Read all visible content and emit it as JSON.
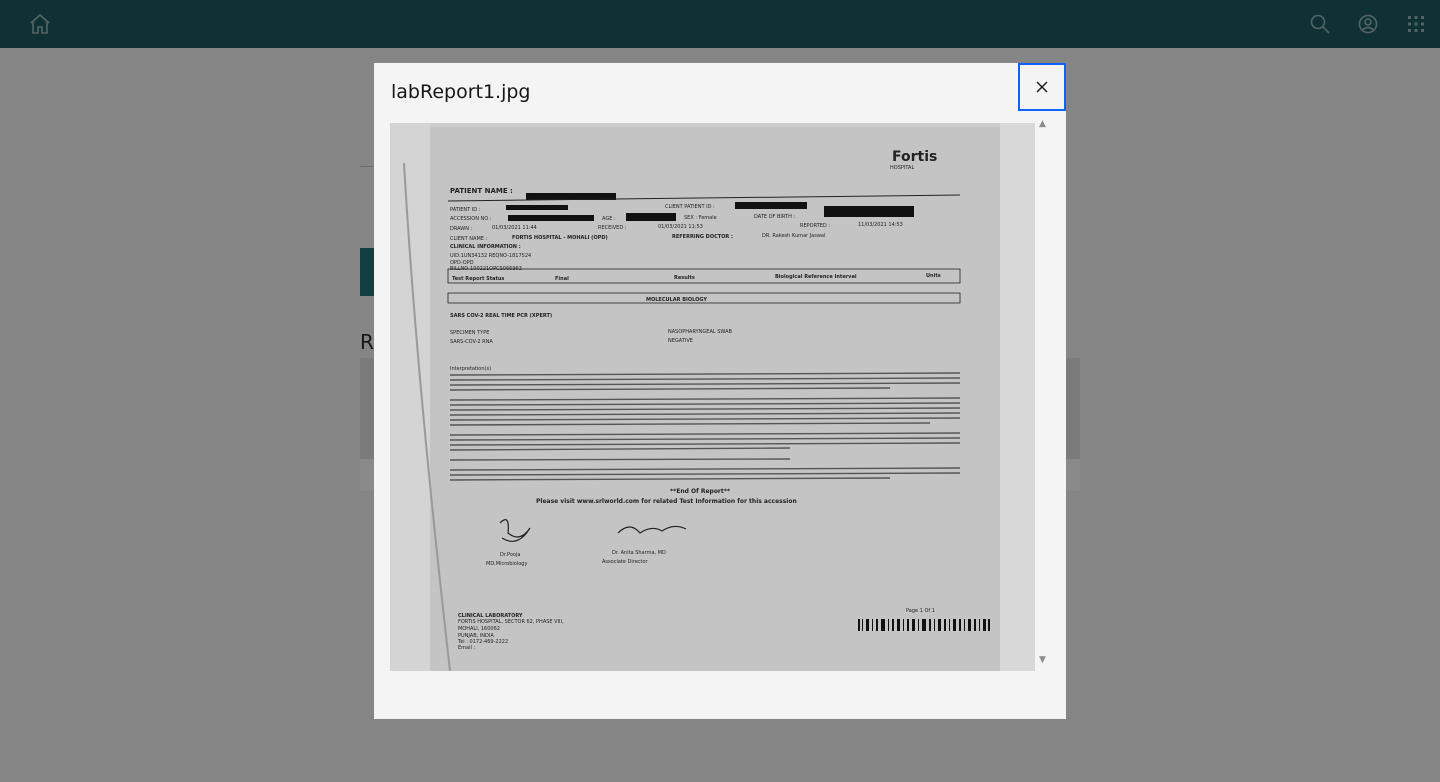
{
  "topbar": {
    "home_icon": "home-icon",
    "search_icon": "search-icon",
    "user_icon": "user-avatar-icon",
    "apps_icon": "app-switcher-icon"
  },
  "background": {
    "heading_initial": "R"
  },
  "modal": {
    "title": "labReport1.jpg",
    "close_icon": "close-icon"
  },
  "document": {
    "logo_text": "Fortis",
    "logo_subtext": "HOSPITAL",
    "patient_name_label": "PATIENT NAME :",
    "patient_id_label": "PATIENT ID :",
    "client_patient_id_label": "CLIENT PATIENT ID :",
    "accession_label": "ACCESSION NO :",
    "age_label": "AGE :",
    "sex_label": "SEX : Female",
    "dob_label": "DATE OF BIRTH :",
    "drawn_label": "DRAWN :",
    "drawn_value": "01/03/2021 11:44",
    "received_label": "RECEIVED :",
    "received_value": "01/03/2021 11:53",
    "reported_label": "REPORTED :",
    "reported_value": "11/03/2021 14:53",
    "client_name_label": "CLIENT NAME :",
    "client_name_value": "FORTIS HOSPITAL - MOHALI (OPD)",
    "referring_label": "REFERRING DOCTOR :",
    "referring_value": "DR. Rakesh Kumar Jaswal",
    "clinical_info_label": "CLINICAL INFORMATION :",
    "clinical_info_lines": [
      "UID:1UN34132 REQNO-1817524",
      "OPD-OPD",
      "BILLNO-100221OPCS066963"
    ],
    "table_headers": [
      "Test Report Status",
      "Final",
      "Results",
      "Biological Reference Interval",
      "Units"
    ],
    "section_title": "MOLECULAR BIOLOGY",
    "test_title": "SARS COV-2 REAL TIME PCR (XPERT)",
    "specimen_label": "SPECIMEN TYPE",
    "specimen_value": "NASOPHARYNGEAL SWAB",
    "rna_label": "SARS-COV-2 RNA",
    "rna_value": "NEGATIVE",
    "interpretation_label": "Interpretation(s)",
    "end_of_report": "**End Of Report**",
    "visit_text": "Please visit www.srlworld.com for related Test Information for this accession",
    "signer1_name": "Dr.Pooja",
    "signer1_title": "MD,Microbiology",
    "signer2_name": "Dr. Anita Sharma, MD",
    "signer2_title": "Associate Director",
    "lab_label": "CLINICAL LABORATORY",
    "lab_address": [
      "FORTIS HOSPITAL, SECTOR 62, PHASE VIII,",
      "MOHALI, 160062",
      "PUNJAB, INDIA"
    ],
    "lab_phone": "Tel : 0172-469-2222",
    "lab_email": "Email : ",
    "page_label": "Page 1 Of 1"
  }
}
